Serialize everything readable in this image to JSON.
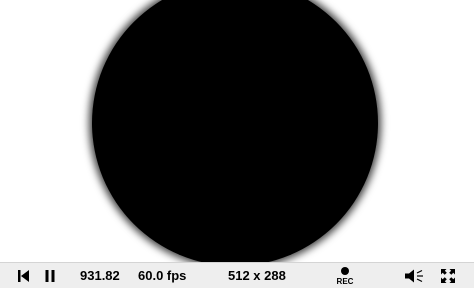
{
  "canvas": {
    "background": "#ffffff",
    "shape_color": "#000000",
    "shape": "circle"
  },
  "controls": {
    "background": "#eeeeee",
    "rewind_icon": "rewind-to-start-icon",
    "pause_icon": "pause-icon",
    "time": "931.82",
    "fps": "60.0 fps",
    "resolution": "512 x 288",
    "record_label": "REC",
    "record_icon": "record-icon",
    "volume_icon": "volume-icon",
    "fullscreen_icon": "fullscreen-icon"
  }
}
